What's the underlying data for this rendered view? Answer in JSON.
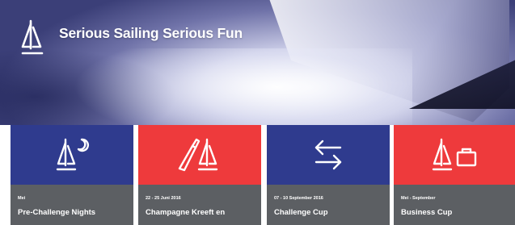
{
  "hero": {
    "title": "Serious Sailing Serious Fun",
    "logo_icon": "sailboat-icon"
  },
  "colors": {
    "blue": "#2f3b8e",
    "red": "#ee3a3c",
    "info_gray": "#5c5f63"
  },
  "cards": [
    {
      "date": "Mei",
      "title": "Pre-Challenge Nights",
      "icon": "sailboat-moon-icon",
      "color": "blue"
    },
    {
      "date": "22 - 25 Juni 2016",
      "title": "Champagne Kreeft en",
      "icon": "champagne-sailboat-icon",
      "color": "red"
    },
    {
      "date": "07 - 10 September 2016",
      "title": "Challenge Cup",
      "icon": "exchange-arrows-icon",
      "color": "blue"
    },
    {
      "date": "Mei - September",
      "title": "Business Cup",
      "icon": "sailboat-briefcase-icon",
      "color": "red"
    }
  ]
}
